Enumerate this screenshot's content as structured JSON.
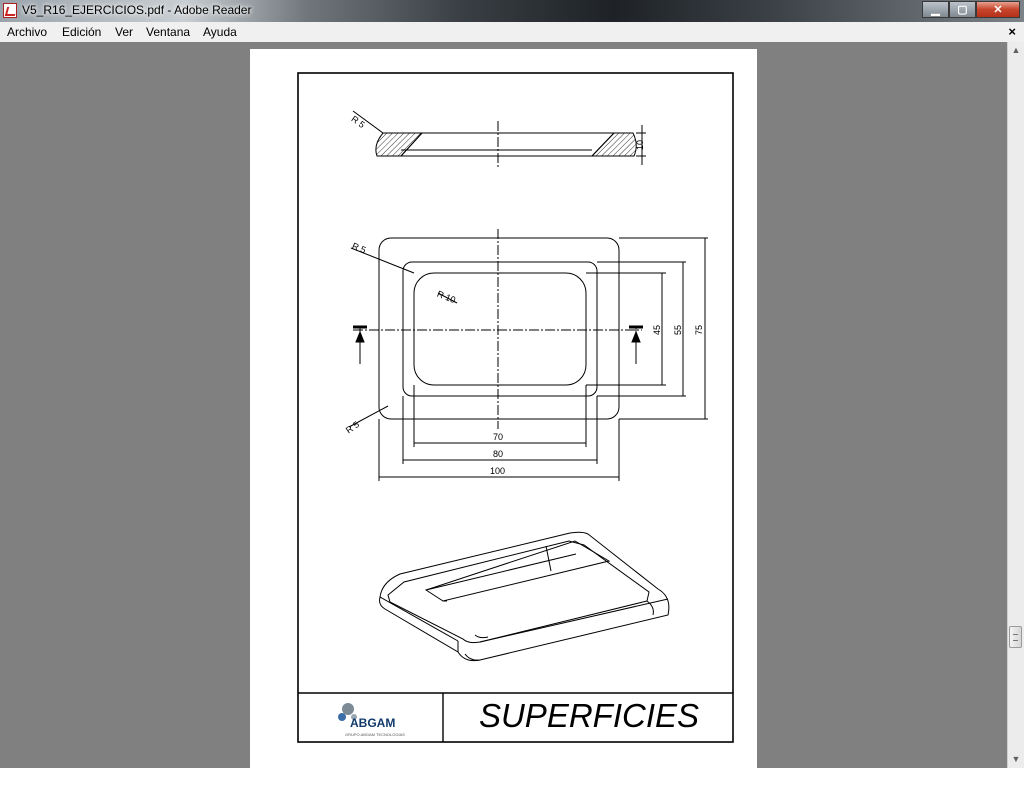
{
  "window": {
    "title": "V5_R16_EJERCICIOS.pdf - Adobe Reader",
    "buttons": {
      "minimize": "▁",
      "maximize": "▢",
      "close": "✕"
    }
  },
  "menu": {
    "items": [
      "Archivo",
      "Edición",
      "Ver",
      "Ventana",
      "Ayuda"
    ],
    "close_doc": "×"
  },
  "scrollbar": {
    "up": "▲",
    "down": "▼"
  },
  "drawing": {
    "title": "SUPERFICIES",
    "logo": "ABGAM",
    "logo_tagline": "GRUPO ABGAM TECNOLOGIAS",
    "dims": {
      "r_section": "R 5",
      "thickness": "10",
      "r_outer": "R 5",
      "r_inner": "R 10",
      "r_bottom": "R 5",
      "h45": "45",
      "h55": "55",
      "h75": "75",
      "w70": "70",
      "w80": "80",
      "w100": "100"
    }
  }
}
